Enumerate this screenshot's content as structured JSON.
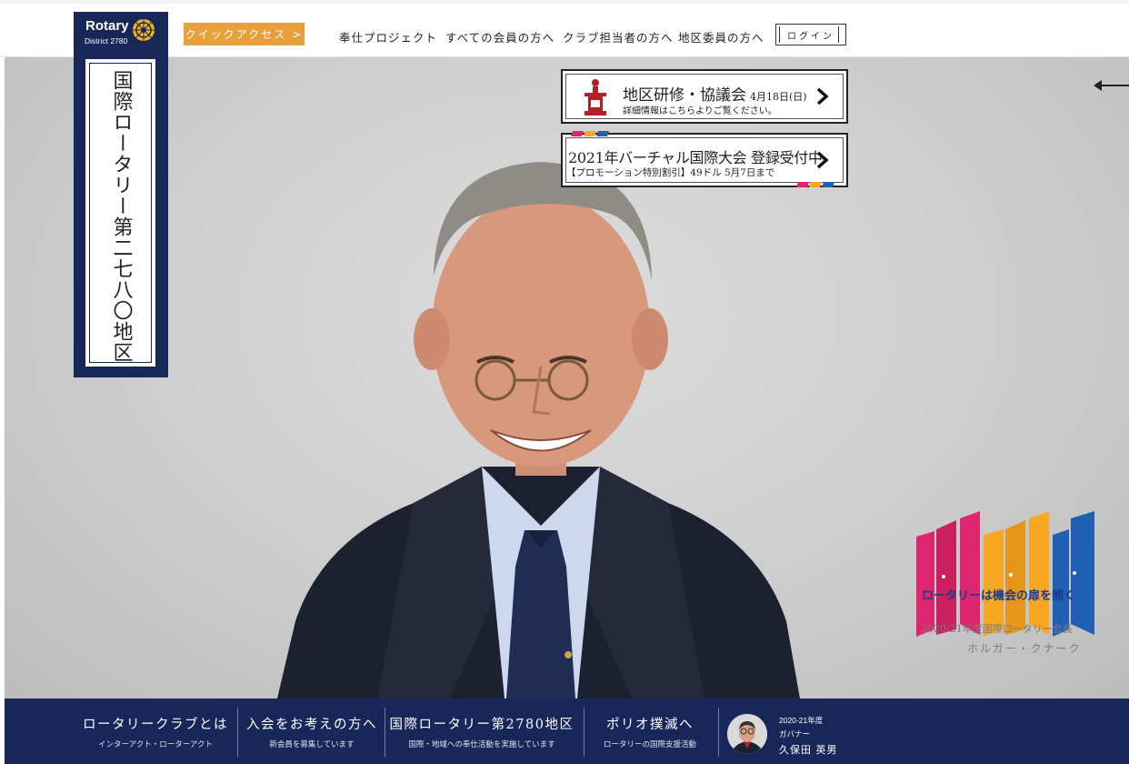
{
  "header": {
    "logo_word": "Rotary",
    "logo_district": "District 2780",
    "quick_access": "クイックアクセス",
    "nav": [
      "奉仕プロジェクト",
      "すべての会員の方へ",
      "クラブ担当者の方へ",
      "地区委員の方へ"
    ],
    "login": "ログイン"
  },
  "banner": {
    "vertical_title": "国際ロータリー第二七八〇地区"
  },
  "announcements": [
    {
      "title": "地区研修・協議会",
      "date": "4月18日(日)",
      "subtitle": "詳細情報はこちらよりご覧ください。"
    },
    {
      "title": "2021年バーチャル国際大会 登録受付中",
      "subtitle": "【プロモーション特別割引】49ドル 5月7日まで"
    }
  ],
  "campaign": {
    "slogan": "ロータリーは機会の扉を開く",
    "president_year": "2020-21年度国際ロータリー会長",
    "president_name": "ホルガー・クナーク"
  },
  "footer": {
    "items": [
      {
        "title": "ロータリークラブとは",
        "subtitle": "インターアクト・ローターアクト"
      },
      {
        "title": "入会をお考えの方へ",
        "subtitle": "新会員を募集しています"
      },
      {
        "title": "国際ロータリー第2780地区",
        "subtitle": "国際・地域への奉仕活動を実施しています"
      },
      {
        "title": "ポリオ撲滅へ",
        "subtitle": "ロータリーの国際支援活動"
      }
    ],
    "governor": {
      "year": "2020-21年度",
      "role": "ガバナー",
      "name": "久保田 英男"
    }
  },
  "colors": {
    "navy": "#17275a",
    "orange": "#e8a13a",
    "door_pink": "#e0256f",
    "door_orange": "#f7a823",
    "door_blue": "#1f5fb4"
  },
  "icons": [
    "rotary-wheel-icon",
    "podium-icon",
    "chevron-right-icon",
    "back-arrow-icon"
  ]
}
